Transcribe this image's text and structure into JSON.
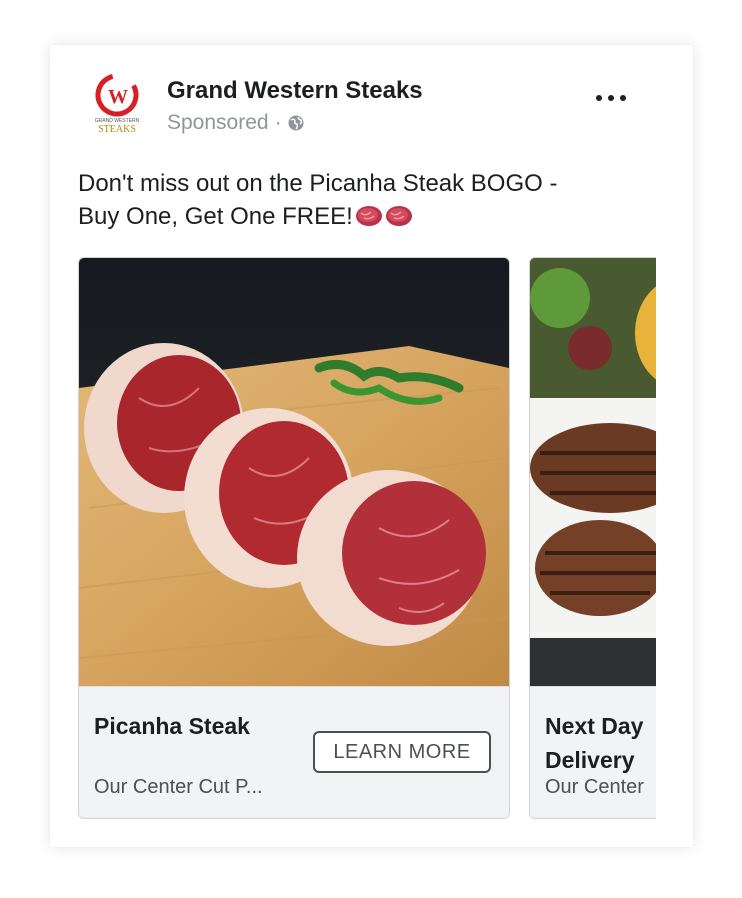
{
  "ad": {
    "page_name": "Grand Western Steaks",
    "sponsored_label": "Sponsored",
    "separator": "·",
    "logo": {
      "icon": "gw-logo-icon",
      "letters": "W",
      "top_text": "GRAND WESTERN",
      "bottom_text": "STEAKS",
      "brand_color": "#d71f26",
      "gold_color": "#b8860b"
    },
    "post_text_line1": "Don't miss out on the Picanha Steak BOGO -",
    "post_text_line2": "Buy One, Get One FREE!",
    "emoji_icon": "raw-steak-emoji-icon"
  },
  "carousel": {
    "cards": [
      {
        "title": "Picanha Steak",
        "description": "Our Center Cut P...",
        "cta_label": "LEARN MORE",
        "image_icon": "picanha-steak-photo"
      },
      {
        "title": "Next Day Delivery",
        "description": "Our Center",
        "image_icon": "grilled-steaks-plate-photo"
      }
    ]
  },
  "colors": {
    "text_primary": "#1c1e21",
    "text_secondary": "#90949c",
    "footer_bg": "#f2f3f5"
  }
}
